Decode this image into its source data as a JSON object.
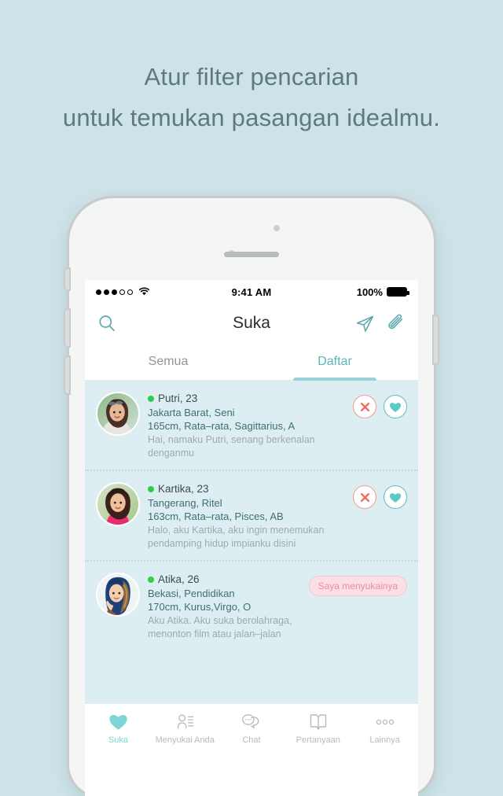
{
  "headline": {
    "line1": "Atur filter pencarian",
    "line2": "untuk temukan pasangan idealmu."
  },
  "statusbar": {
    "time": "9:41 AM",
    "battery_percent": "100%",
    "signal_icon": "signal-dots-icon",
    "wifi_icon": "wifi-icon",
    "battery_icon": "battery-full-icon"
  },
  "navbar": {
    "title": "Suka",
    "search_icon": "search-icon",
    "send_icon": "send-paper-plane-icon",
    "attach_icon": "paperclip-icon"
  },
  "tabs": [
    {
      "label": "Semua",
      "active": false
    },
    {
      "label": "Daftar",
      "active": true
    }
  ],
  "list": [
    {
      "name_age": "Putri, 23",
      "location_job": "Jakarta Barat, Seni",
      "details": "165cm, Rata–rata, Sagittarius, A",
      "bio": "Hai, namaku Putri, senang berkenalan denganmu",
      "online": true,
      "action_type": "buttons",
      "reject_label": "✕",
      "like_label": "♥"
    },
    {
      "name_age": "Kartika, 23",
      "location_job": "Tangerang, Ritel",
      "details": "163cm, Rata–rata, Pisces, AB",
      "bio": "Halo, aku Kartika, aku ingin menemukan pendamping hidup impianku disini",
      "online": true,
      "action_type": "buttons",
      "reject_label": "✕",
      "like_label": "♥"
    },
    {
      "name_age": "Atika, 26",
      "location_job": "Bekasi, Pendidikan",
      "details": "170cm, Kurus,Virgo, O",
      "bio": "Aku Atika. Aku suka berolahraga, menonton film atau jalan–jalan",
      "online": true,
      "action_type": "badge",
      "badge_label": "Saya menyukainya"
    }
  ],
  "tabbar": [
    {
      "label": "Suka",
      "icon": "heart-filled-icon",
      "active": true
    },
    {
      "label": "Menyukai Anda",
      "icon": "person-list-icon",
      "active": false
    },
    {
      "label": "Chat",
      "icon": "chat-bubbles-icon",
      "active": false
    },
    {
      "label": "Pertanyaan",
      "icon": "open-book-icon",
      "active": false
    },
    {
      "label": "Lainnya",
      "icon": "more-dots-icon",
      "active": false
    }
  ],
  "colors": {
    "background": "#cde3e8",
    "headline_text": "#5b7b80",
    "accent_teal": "#5ab5bd",
    "list_background": "#ddeef2",
    "meta_text": "#3f6d74",
    "bio_text": "#a0a9aa",
    "reject_border": "#f09a96",
    "like_border": "#5cbcc1",
    "badge_pink": "#f0899f",
    "online_green": "#2fce4a"
  }
}
